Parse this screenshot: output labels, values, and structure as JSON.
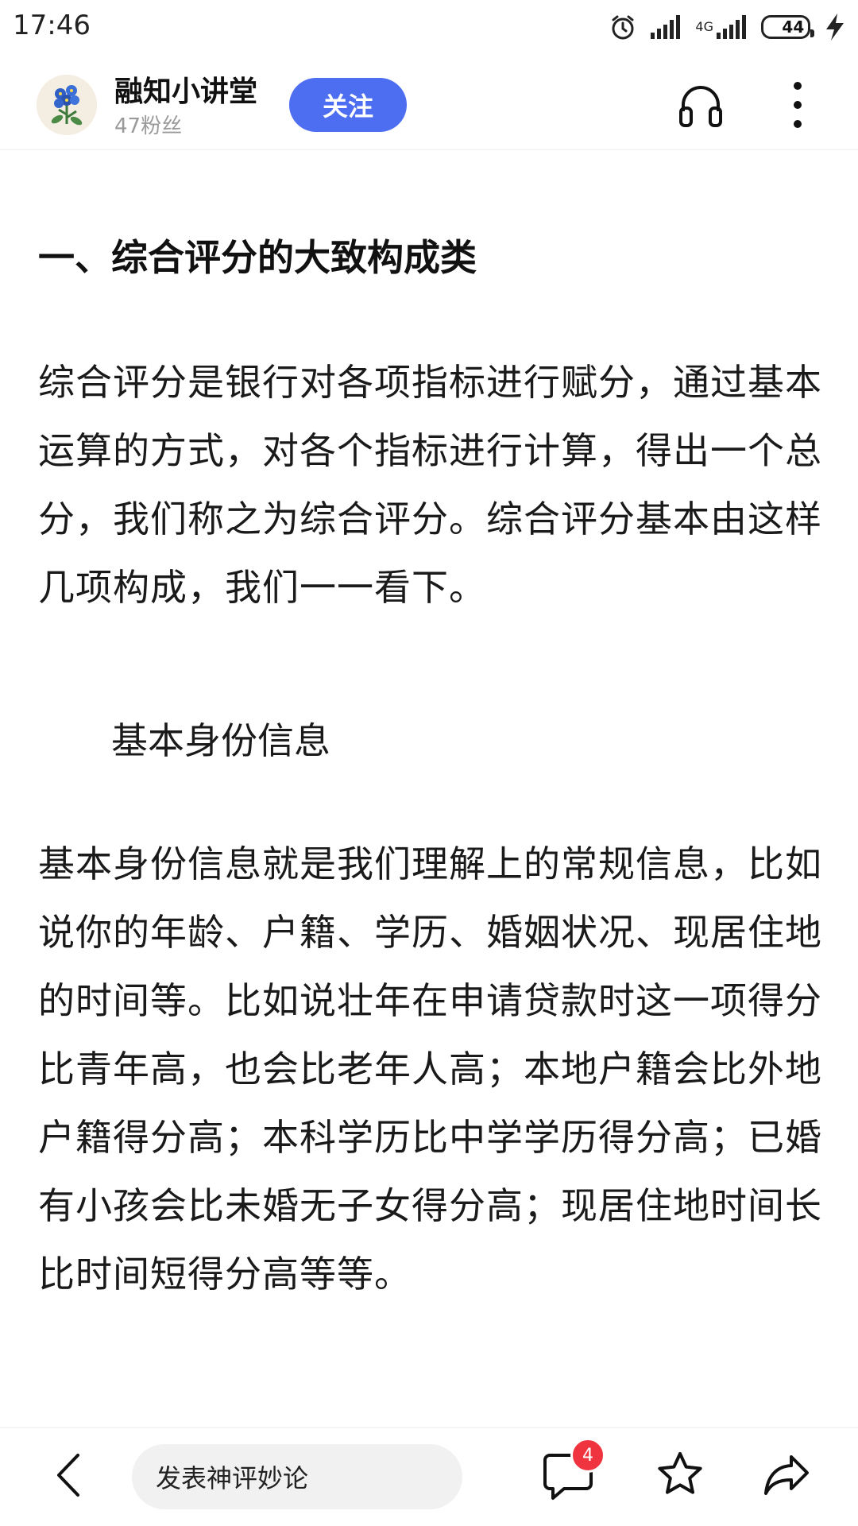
{
  "status_bar": {
    "time": "17:46",
    "network": "4G",
    "battery": "44",
    "icons": [
      "alarm-icon",
      "signal-icon",
      "signal-4g-icon",
      "battery-icon",
      "charging-icon"
    ]
  },
  "header": {
    "author_name": "融知小讲堂",
    "fans": "47粉丝",
    "follow_label": "关注",
    "accent_color": "#4e6ef2",
    "icons": [
      "avatar-flower",
      "headphone-icon",
      "more-vertical-icon"
    ]
  },
  "article": {
    "heading": "一、综合评分的大致构成类",
    "paragraph1": "综合评分是银行对各项指标进行赋分，通过基本运算的方式，对各个指标进行计算，得出一个总分，我们称之为综合评分。综合评分基本由这样几项构成，我们一一看下。",
    "subheading": "基本身份信息",
    "paragraph2": "基本身份信息就是我们理解上的常规信息，比如说你的年龄、户籍、学历、婚姻状况、现居住地的时间等。比如说壮年在申请贷款时这一项得分比青年高，也会比老年人高；本地户籍会比外地户籍得分高；本科学历比中学学历得分高；已婚有小孩会比未婚无子女得分高；现居住地时间长比时间短得分高等等。"
  },
  "bottom_bar": {
    "comment_placeholder": "发表神评妙论",
    "comment_count": "4",
    "badge_color": "#f0343f",
    "icons": [
      "back-icon",
      "comment-icon",
      "star-icon",
      "share-icon"
    ]
  }
}
